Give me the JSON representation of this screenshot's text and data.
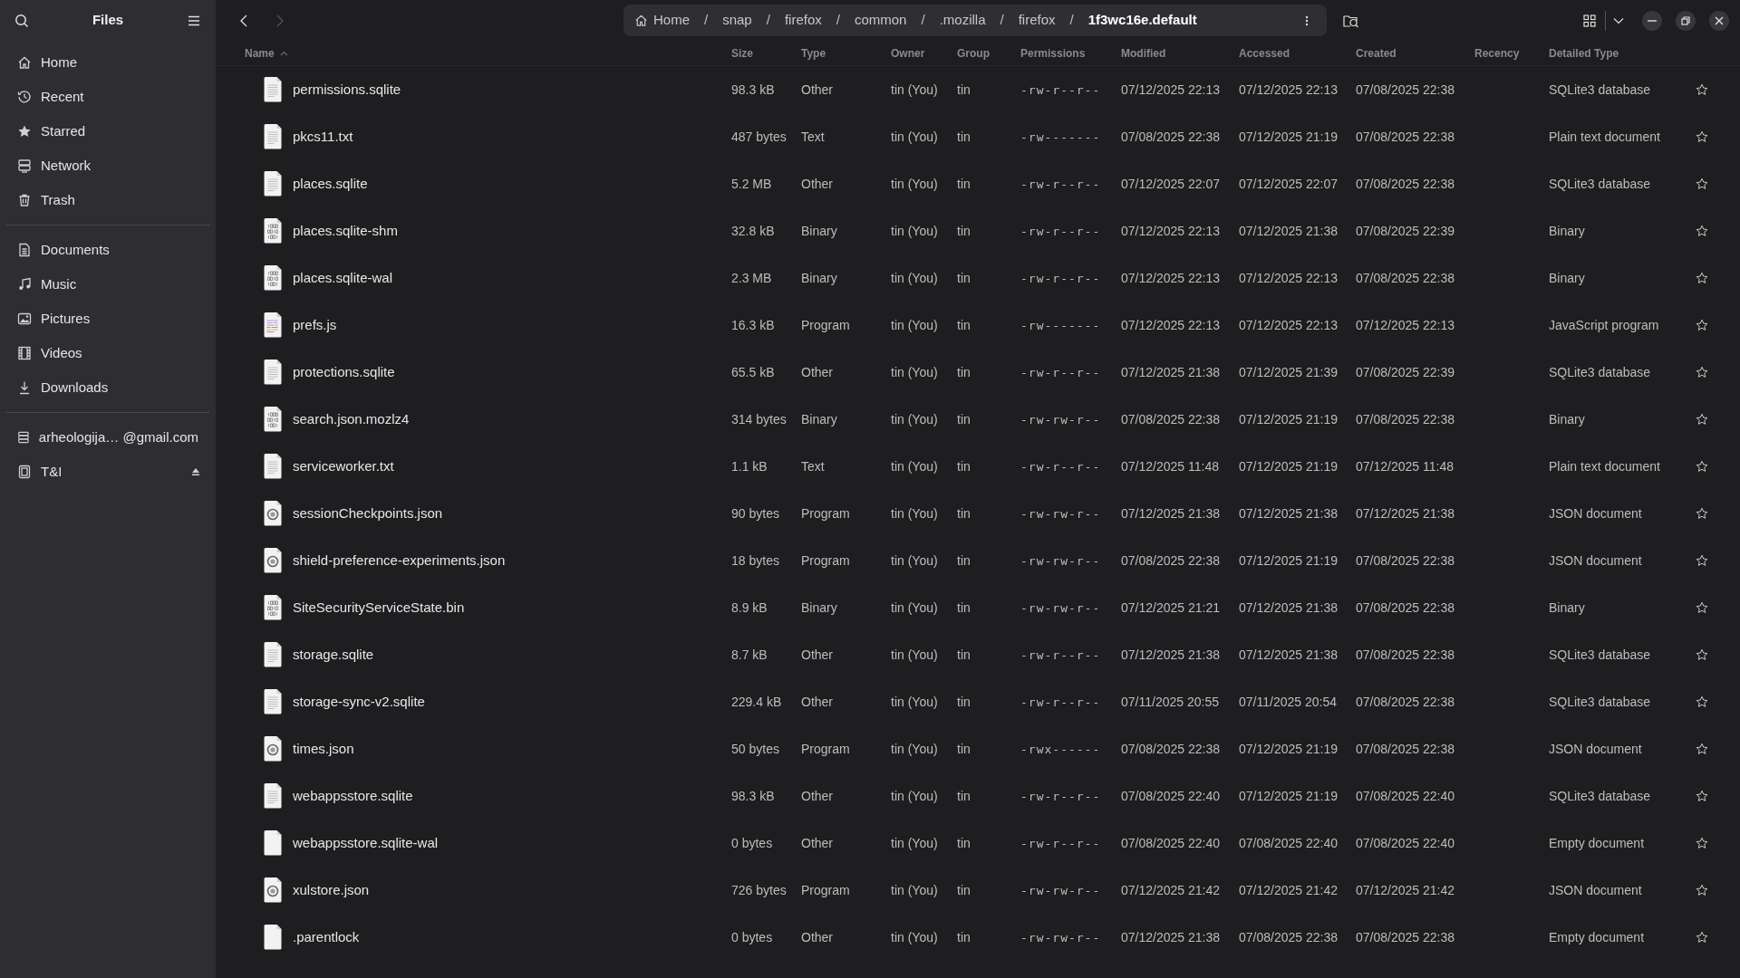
{
  "sidebar": {
    "title": "Files",
    "places": [
      {
        "label": "Home",
        "kind": "home"
      },
      {
        "label": "Recent",
        "kind": "recent"
      },
      {
        "label": "Starred",
        "kind": "starred"
      },
      {
        "label": "Network",
        "kind": "network"
      },
      {
        "label": "Trash",
        "kind": "trash"
      }
    ],
    "bookmarks": [
      {
        "label": "Documents",
        "kind": "documents"
      },
      {
        "label": "Music",
        "kind": "music"
      },
      {
        "label": "Pictures",
        "kind": "pictures"
      },
      {
        "label": "Videos",
        "kind": "videos"
      },
      {
        "label": "Downloads",
        "kind": "downloads"
      }
    ],
    "devices": [
      {
        "label": "arheologija… @gmail.com",
        "kind": "account",
        "ejectable": false
      },
      {
        "label": "T&I",
        "kind": "drive",
        "ejectable": true
      }
    ]
  },
  "toolbar": {
    "back_enabled": true,
    "forward_enabled": false,
    "breadcrumbs": [
      {
        "label": "Home",
        "current": false
      },
      {
        "label": "snap",
        "current": false
      },
      {
        "label": "firefox",
        "current": false
      },
      {
        "label": "common",
        "current": false
      },
      {
        "label": ".mozilla",
        "current": false
      },
      {
        "label": "firefox",
        "current": false
      },
      {
        "label": "1f3wc16e.default",
        "current": true
      }
    ],
    "separator": "/"
  },
  "table": {
    "columns": [
      {
        "label": "Name",
        "sorted": true
      },
      {
        "label": "Size",
        "sorted": false
      },
      {
        "label": "Type",
        "sorted": false
      },
      {
        "label": "Owner",
        "sorted": false
      },
      {
        "label": "Group",
        "sorted": false
      },
      {
        "label": "Permissions",
        "sorted": false
      },
      {
        "label": "Modified",
        "sorted": false
      },
      {
        "label": "Accessed",
        "sorted": false
      },
      {
        "label": "Created",
        "sorted": false
      },
      {
        "label": "Recency",
        "sorted": false
      },
      {
        "label": "Detailed Type",
        "sorted": false
      }
    ],
    "rows": [
      {
        "kind": "document",
        "name": "permissions.sqlite",
        "size": "98.3 kB",
        "type": "Other",
        "owner": "tin (You)",
        "group": "tin",
        "permissions": "-rw-r--r--",
        "modified": "07/12/2025 22:13",
        "accessed": "07/12/2025 22:13",
        "created": "07/08/2025 22:38",
        "detailed_type": "SQLite3 database",
        "starred": false
      },
      {
        "kind": "document",
        "name": "pkcs11.txt",
        "size": "487 bytes",
        "type": "Text",
        "owner": "tin (You)",
        "group": "tin",
        "permissions": "-rw-------",
        "modified": "07/08/2025 22:38",
        "accessed": "07/12/2025 21:19",
        "created": "07/08/2025 22:38",
        "detailed_type": "Plain text document",
        "starred": false
      },
      {
        "kind": "document",
        "name": "places.sqlite",
        "size": "5.2 MB",
        "type": "Other",
        "owner": "tin (You)",
        "group": "tin",
        "permissions": "-rw-r--r--",
        "modified": "07/12/2025 22:07",
        "accessed": "07/12/2025 22:07",
        "created": "07/08/2025 22:38",
        "detailed_type": "SQLite3 database",
        "starred": false
      },
      {
        "kind": "binary",
        "name": "places.sqlite-shm",
        "size": "32.8 kB",
        "type": "Binary",
        "owner": "tin (You)",
        "group": "tin",
        "permissions": "-rw-r--r--",
        "modified": "07/12/2025 22:13",
        "accessed": "07/12/2025 21:38",
        "created": "07/08/2025 22:39",
        "detailed_type": "Binary",
        "starred": false
      },
      {
        "kind": "binary",
        "name": "places.sqlite-wal",
        "size": "2.3 MB",
        "type": "Binary",
        "owner": "tin (You)",
        "group": "tin",
        "permissions": "-rw-r--r--",
        "modified": "07/12/2025 22:13",
        "accessed": "07/12/2025 22:13",
        "created": "07/08/2025 22:38",
        "detailed_type": "Binary",
        "starred": false
      },
      {
        "kind": "script",
        "name": "prefs.js",
        "size": "16.3 kB",
        "type": "Program",
        "owner": "tin (You)",
        "group": "tin",
        "permissions": "-rw-------",
        "modified": "07/12/2025 22:13",
        "accessed": "07/12/2025 22:13",
        "created": "07/12/2025 22:13",
        "detailed_type": "JavaScript program",
        "starred": false
      },
      {
        "kind": "document",
        "name": "protections.sqlite",
        "size": "65.5 kB",
        "type": "Other",
        "owner": "tin (You)",
        "group": "tin",
        "permissions": "-rw-r--r--",
        "modified": "07/12/2025 21:38",
        "accessed": "07/12/2025 21:39",
        "created": "07/08/2025 22:39",
        "detailed_type": "SQLite3 database",
        "starred": false
      },
      {
        "kind": "binary",
        "name": "search.json.mozlz4",
        "size": "314 bytes",
        "type": "Binary",
        "owner": "tin (You)",
        "group": "tin",
        "permissions": "-rw-rw-r--",
        "modified": "07/08/2025 22:38",
        "accessed": "07/12/2025 21:19",
        "created": "07/08/2025 22:38",
        "detailed_type": "Binary",
        "starred": false
      },
      {
        "kind": "document",
        "name": "serviceworker.txt",
        "size": "1.1 kB",
        "type": "Text",
        "owner": "tin (You)",
        "group": "tin",
        "permissions": "-rw-r--r--",
        "modified": "07/12/2025 11:48",
        "accessed": "07/12/2025 21:19",
        "created": "07/12/2025 11:48",
        "detailed_type": "Plain text document",
        "starred": false
      },
      {
        "kind": "json",
        "name": "sessionCheckpoints.json",
        "size": "90 bytes",
        "type": "Program",
        "owner": "tin (You)",
        "group": "tin",
        "permissions": "-rw-rw-r--",
        "modified": "07/12/2025 21:38",
        "accessed": "07/12/2025 21:38",
        "created": "07/12/2025 21:38",
        "detailed_type": "JSON document",
        "starred": false
      },
      {
        "kind": "json",
        "name": "shield-preference-experiments.json",
        "size": "18 bytes",
        "type": "Program",
        "owner": "tin (You)",
        "group": "tin",
        "permissions": "-rw-rw-r--",
        "modified": "07/08/2025 22:38",
        "accessed": "07/12/2025 21:19",
        "created": "07/08/2025 22:38",
        "detailed_type": "JSON document",
        "starred": false
      },
      {
        "kind": "binary",
        "name": "SiteSecurityServiceState.bin",
        "size": "8.9 kB",
        "type": "Binary",
        "owner": "tin (You)",
        "group": "tin",
        "permissions": "-rw-rw-r--",
        "modified": "07/12/2025 21:21",
        "accessed": "07/12/2025 21:38",
        "created": "07/08/2025 22:38",
        "detailed_type": "Binary",
        "starred": false
      },
      {
        "kind": "document",
        "name": "storage.sqlite",
        "size": "8.7 kB",
        "type": "Other",
        "owner": "tin (You)",
        "group": "tin",
        "permissions": "-rw-r--r--",
        "modified": "07/12/2025 21:38",
        "accessed": "07/12/2025 21:38",
        "created": "07/08/2025 22:38",
        "detailed_type": "SQLite3 database",
        "starred": false
      },
      {
        "kind": "document",
        "name": "storage-sync-v2.sqlite",
        "size": "229.4 kB",
        "type": "Other",
        "owner": "tin (You)",
        "group": "tin",
        "permissions": "-rw-r--r--",
        "modified": "07/11/2025 20:55",
        "accessed": "07/11/2025 20:54",
        "created": "07/08/2025 22:38",
        "detailed_type": "SQLite3 database",
        "starred": false
      },
      {
        "kind": "json",
        "name": "times.json",
        "size": "50 bytes",
        "type": "Program",
        "owner": "tin (You)",
        "group": "tin",
        "permissions": "-rwx------",
        "modified": "07/08/2025 22:38",
        "accessed": "07/12/2025 21:19",
        "created": "07/08/2025 22:38",
        "detailed_type": "JSON document",
        "starred": false
      },
      {
        "kind": "document",
        "name": "webappsstore.sqlite",
        "size": "98.3 kB",
        "type": "Other",
        "owner": "tin (You)",
        "group": "tin",
        "permissions": "-rw-r--r--",
        "modified": "07/08/2025 22:40",
        "accessed": "07/12/2025 21:19",
        "created": "07/08/2025 22:40",
        "detailed_type": "SQLite3 database",
        "starred": false
      },
      {
        "kind": "empty",
        "name": "webappsstore.sqlite-wal",
        "size": "0 bytes",
        "type": "Other",
        "owner": "tin (You)",
        "group": "tin",
        "permissions": "-rw-r--r--",
        "modified": "07/08/2025 22:40",
        "accessed": "07/08/2025 22:40",
        "created": "07/08/2025 22:40",
        "detailed_type": "Empty document",
        "starred": false
      },
      {
        "kind": "json",
        "name": "xulstore.json",
        "size": "726 bytes",
        "type": "Program",
        "owner": "tin (You)",
        "group": "tin",
        "permissions": "-rw-rw-r--",
        "modified": "07/12/2025 21:42",
        "accessed": "07/12/2025 21:42",
        "created": "07/12/2025 21:42",
        "detailed_type": "JSON document",
        "starred": false
      },
      {
        "kind": "empty",
        "name": ".parentlock",
        "size": "0 bytes",
        "type": "Other",
        "owner": "tin (You)",
        "group": "tin",
        "permissions": "-rw-rw-r--",
        "modified": "07/12/2025 21:38",
        "accessed": "07/08/2025 22:38",
        "created": "07/08/2025 22:38",
        "detailed_type": "Empty document",
        "starred": false
      }
    ]
  }
}
